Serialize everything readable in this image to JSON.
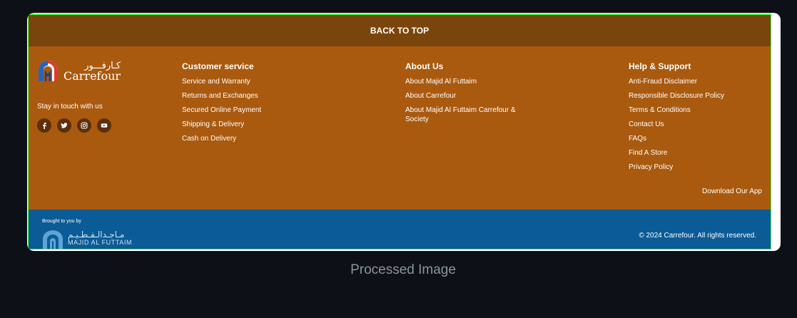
{
  "back_to_top": "BACK TO TOP",
  "brand": {
    "arabic": "كـارفـــور",
    "name": "Carrefour"
  },
  "stay_in_touch": "Stay in touch with us",
  "socials": [
    {
      "icon": "facebook-icon",
      "glyph": "f"
    },
    {
      "icon": "twitter-icon",
      "glyph": "t"
    },
    {
      "icon": "instagram-icon",
      "glyph": "ig"
    },
    {
      "icon": "youtube-icon",
      "glyph": "yt"
    }
  ],
  "customer_service": {
    "title": "Customer service",
    "items": [
      "Service and Warranty",
      "Returns and Exchanges",
      "Secured Online Payment",
      "Shipping & Delivery",
      "Cash on Delivery"
    ]
  },
  "about_us": {
    "title": "About Us",
    "items": [
      "About Majid Al Futtaim",
      "About Carrefour",
      "About Majid Al Futtaim Carrefour & Society"
    ]
  },
  "help_support": {
    "title": "Help & Support",
    "items": [
      "Anti-Fraud Disclaimer",
      "Responsible Disclosure Policy",
      "Terms & Conditions",
      "Contact Us",
      "FAQs",
      "Find A Store",
      "Privacy Policy"
    ]
  },
  "download_app": "Download Our App",
  "brought_to_you_by": "Brought to you by",
  "maf": {
    "arabic": "مـاجـدالـفـطـيـم",
    "latin": "MAJID AL FUTTAIM"
  },
  "copyright": "© 2024 Carrefour. All rights reserved.",
  "caption": "Processed Image",
  "colors": {
    "background": "#0d1117",
    "top_bar": "#7a450c",
    "main": "#a95a0f",
    "bottom": "#0b5b96",
    "frame_border": "#4cff4c"
  }
}
